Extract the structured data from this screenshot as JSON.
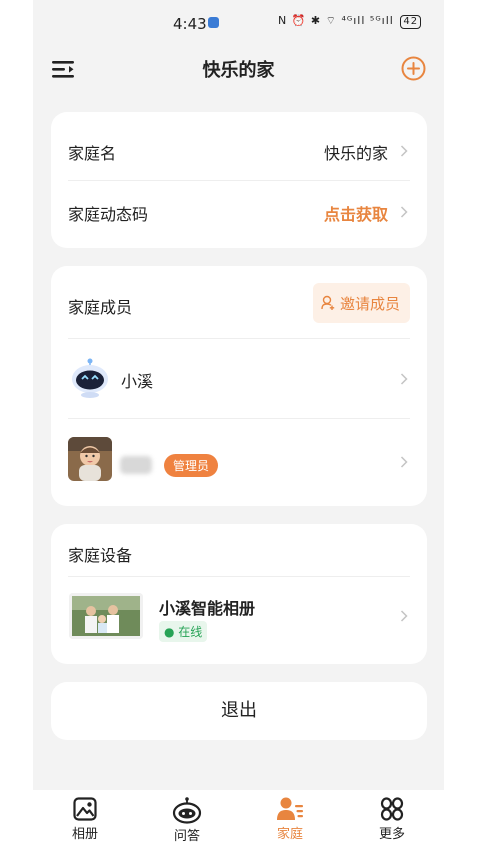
{
  "status_bar": {
    "time": "4:43",
    "battery": "42",
    "signal_text": "N ⏰ ✱ ⌔ ⁴ᴳıll ⁵ᴳıll"
  },
  "header": {
    "title": "快乐的家"
  },
  "family_info": {
    "name_label": "家庭名",
    "name_value": "快乐的家",
    "code_label": "家庭动态码",
    "code_action": "点击获取"
  },
  "members": {
    "title": "家庭成员",
    "invite_label": "邀请成员",
    "list": [
      {
        "name": "小溪",
        "badge": ""
      },
      {
        "name": "",
        "badge": "管理员"
      }
    ]
  },
  "devices": {
    "title": "家庭设备",
    "list": [
      {
        "name": "小溪智能相册",
        "status": "在线"
      }
    ]
  },
  "logout_label": "退出",
  "nav": {
    "tabs": [
      {
        "label": "相册",
        "icon": "album-icon"
      },
      {
        "label": "问答",
        "icon": "robot-icon"
      },
      {
        "label": "家庭",
        "icon": "family-icon"
      },
      {
        "label": "更多",
        "icon": "more-icon"
      }
    ]
  },
  "colors": {
    "accent": "#e8853f",
    "badge": "#ef8240",
    "online": "#27a356",
    "background": "#f3f3f3"
  }
}
